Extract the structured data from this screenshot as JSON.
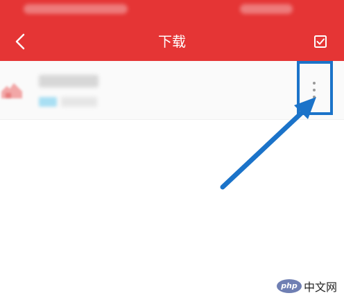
{
  "app_bar": {
    "title": "下载",
    "back_icon": "chevron-left-icon",
    "select_icon": "checkbox-icon"
  },
  "list": {
    "items": [
      {
        "icon": "download-app-icon",
        "more_icon": "more-vertical-icon"
      }
    ]
  },
  "watermark": {
    "logo_text": "php",
    "text": "中文网"
  },
  "colors": {
    "header": "#e53535",
    "highlight": "#1b73c9"
  }
}
